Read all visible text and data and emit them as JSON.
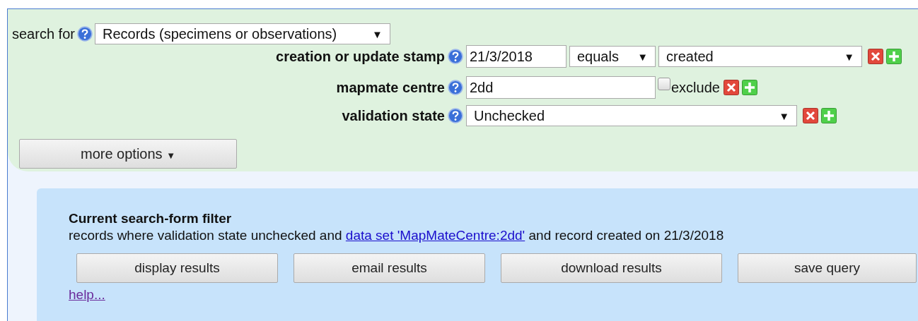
{
  "search_for": {
    "label": "search for",
    "value": "Records (specimens or observations)",
    "caret": "▼"
  },
  "filters": [
    {
      "kind": "date",
      "label": "creation or update stamp",
      "value": "21/3/2018",
      "operator": "equals",
      "operator_caret": "▼",
      "type": "created",
      "type_caret": "▼"
    },
    {
      "kind": "text",
      "label": "mapmate centre",
      "value": "2dd",
      "exclude_label": "exclude",
      "exclude_checked": false
    },
    {
      "kind": "select",
      "label": "validation state",
      "value": "Unchecked",
      "caret": "▼"
    }
  ],
  "more_options": {
    "label": "more options",
    "caret": "▼"
  },
  "current_filter": {
    "title": "Current search-form filter",
    "before": "records where validation state unchecked and ",
    "link": "data set 'MapMateCentre:2dd'",
    "after": " and record created on 21/3/2018"
  },
  "buttons": [
    "display results",
    "email results",
    "download results",
    "save query"
  ],
  "help_link": "help..."
}
